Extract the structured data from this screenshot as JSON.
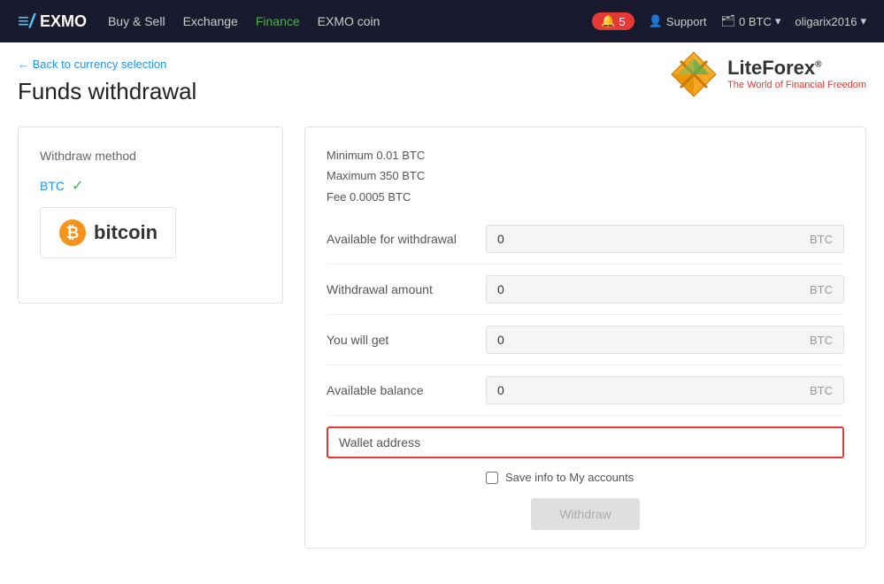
{
  "navbar": {
    "logo_text": "EXMO",
    "links": [
      {
        "label": "Buy & Sell",
        "active": false
      },
      {
        "label": "Exchange",
        "active": false
      },
      {
        "label": "Finance",
        "active": true
      },
      {
        "label": "EXMO coin",
        "active": false
      }
    ],
    "notification_count": "5",
    "support_label": "Support",
    "balance_label": "0 BTC",
    "user_label": "oligarix2016"
  },
  "breadcrumb": {
    "back_label": "← Back to currency selection"
  },
  "page": {
    "title": "Funds withdrawal"
  },
  "liteforex": {
    "name": "LiteForex",
    "registered_symbol": "®",
    "tagline": "The World of Financial Freedom"
  },
  "left_panel": {
    "section_label": "Withdraw method",
    "selected_method": "BTC",
    "bitcoin_label": "bitcoin"
  },
  "right_panel": {
    "info": {
      "minimum": "Minimum 0.01 BTC",
      "maximum": "Maximum 350 BTC",
      "fee": "Fee 0.0005 BTC"
    },
    "fields": [
      {
        "label": "Available for withdrawal",
        "value": "0",
        "currency": "BTC"
      },
      {
        "label": "Withdrawal amount",
        "value": "0",
        "currency": "BTC"
      },
      {
        "label": "You will get",
        "value": "0",
        "currency": "BTC"
      },
      {
        "label": "Available balance",
        "value": "0",
        "currency": "BTC"
      }
    ],
    "wallet_address_label": "Wallet address",
    "wallet_address_placeholder": "",
    "save_label": "Save info to My accounts",
    "withdraw_button": "Withdraw"
  }
}
